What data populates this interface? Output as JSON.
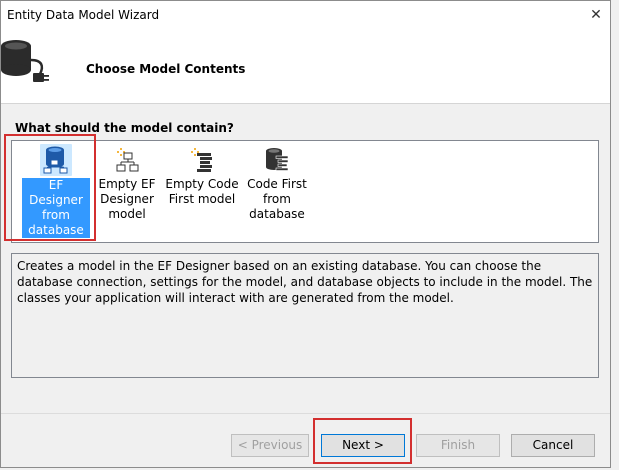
{
  "window": {
    "title": "Entity Data Model Wizard",
    "close_glyph": "✕"
  },
  "header": {
    "title": "Choose Model Contents",
    "icon": "database-plug-icon"
  },
  "question": "What should the model contain?",
  "options": [
    {
      "label": "EF Designer from database",
      "icon": "ef-designer-database-icon",
      "selected": true
    },
    {
      "label": "Empty EF Designer model",
      "icon": "empty-ef-designer-icon",
      "selected": false
    },
    {
      "label": "Empty Code First model",
      "icon": "empty-code-first-icon",
      "selected": false
    },
    {
      "label": "Code First from database",
      "icon": "code-first-database-icon",
      "selected": false
    }
  ],
  "option_lines": [
    [
      "EF Designer",
      "from",
      "database"
    ],
    [
      "Empty EF",
      "Designer",
      "model"
    ],
    [
      "Empty Code",
      "First model"
    ],
    [
      "Code First",
      "from",
      "database"
    ]
  ],
  "description": "Creates a model in the EF Designer based on an existing database. You can choose the database connection, settings for the model, and database objects to include in the model. The classes your application will interact with are generated from the model.",
  "buttons": {
    "previous": "< Previous",
    "next": "Next >",
    "finish": "Finish",
    "cancel": "Cancel"
  },
  "colors": {
    "selection": "#3399ff",
    "highlight": "#d32f2f"
  }
}
